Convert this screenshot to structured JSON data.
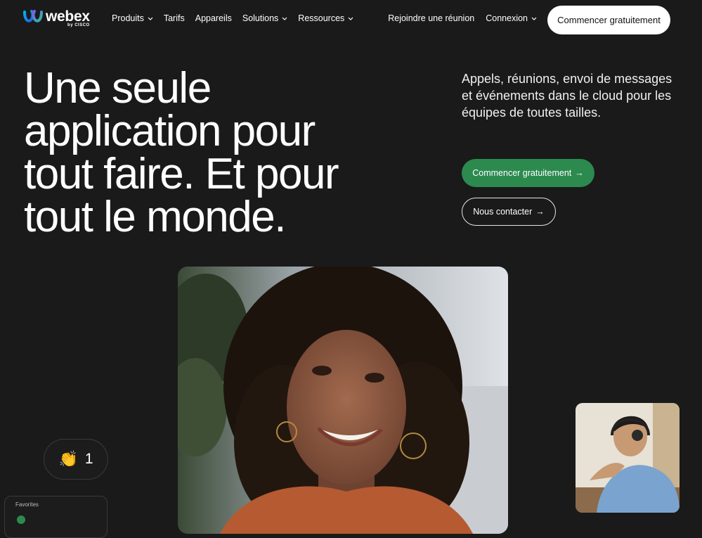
{
  "brand": {
    "name": "webex",
    "by": "by CISCO"
  },
  "nav": {
    "left": [
      {
        "label": "Produits",
        "dropdown": true
      },
      {
        "label": "Tarifs",
        "dropdown": false
      },
      {
        "label": "Appareils",
        "dropdown": false
      },
      {
        "label": "Solutions",
        "dropdown": true
      },
      {
        "label": "Ressources",
        "dropdown": true
      }
    ],
    "join_label": "Rejoindre une réunion",
    "login_label": "Connexion",
    "cta_label": "Commencer gratuitement"
  },
  "hero": {
    "title": "Une seule application pour tout faire. Et pour tout le monde.",
    "description": "Appels, réunions, envoi de messages et événements dans le cloud pour les équipes de toutes tailles.",
    "primary_button": "Commencer gratuitement",
    "secondary_button": "Nous contacter",
    "arrow": "→"
  },
  "media": {
    "main_video_alt": "smiling-woman-video-tile",
    "side_video_alt": "man-with-headset-video-tile",
    "reaction_emoji": "👏",
    "reaction_count": "1",
    "favorites_label": "Favorites"
  },
  "colors": {
    "background": "#1a1a1a",
    "accent_green": "#2c8a4f",
    "text": "#ffffff"
  }
}
